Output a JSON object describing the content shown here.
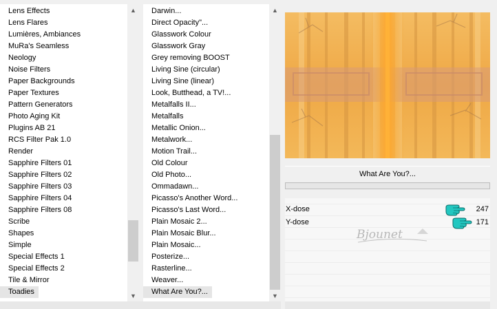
{
  "left_list": {
    "items": [
      "Lens Effects",
      "Lens Flares",
      "Lumières, Ambiances",
      "MuRa's Seamless",
      "Neology",
      "Noise Filters",
      "Paper Backgrounds",
      "Paper Textures",
      "Pattern Generators",
      "Photo Aging Kit",
      "Plugins AB 21",
      "RCS Filter Pak 1.0",
      "Render",
      "Sapphire Filters 01",
      "Sapphire Filters 02",
      "Sapphire Filters 03",
      "Sapphire Filters 04",
      "Sapphire Filters 08",
      "Scribe",
      "Shapes",
      "Simple",
      "Special Effects 1",
      "Special Effects 2",
      "Tile & Mirror",
      "Toadies"
    ],
    "selected": "Toadies"
  },
  "filter_list": {
    "items": [
      "Darwin...",
      "Direct Opacity\"...",
      "Glasswork Colour",
      "Glasswork Gray",
      "Grey removing BOOST",
      "Living Sine (circular)",
      "Living Sine (linear)",
      "Look, Butthead, a TV!...",
      "Metalfalls II...",
      "Metalfalls",
      "Metallic Onion...",
      "Metalwork...",
      "Motion Trail...",
      "Old Colour",
      "Old Photo...",
      "Ommadawn...",
      "Picasso's Another Word...",
      "Picasso's Last Word...",
      "Plain Mosaic 2...",
      "Plain Mosaic Blur...",
      "Plain Mosaic...",
      "Posterize...",
      "Rasterline...",
      "Weaver...",
      "What Are You?..."
    ],
    "selected": "What Are You?..."
  },
  "preview": {
    "colors": {
      "base": "#f2b24e",
      "light": "#f6c879",
      "dark": "#c98a3a",
      "band": "#d59a7c"
    }
  },
  "filter_title": "What Are You?...",
  "params": [
    {
      "label": "X-dose",
      "value": "247",
      "icon": "pointing-hand-icon"
    },
    {
      "label": "Y-dose",
      "value": "171",
      "icon": "pointing-hand-icon"
    }
  ],
  "watermark_text": "Bjounet",
  "colors": {
    "hand_icon": "#22c7c0",
    "scroll_thumb": "#cdcdcd",
    "selected_row": "#e5e5e5"
  }
}
